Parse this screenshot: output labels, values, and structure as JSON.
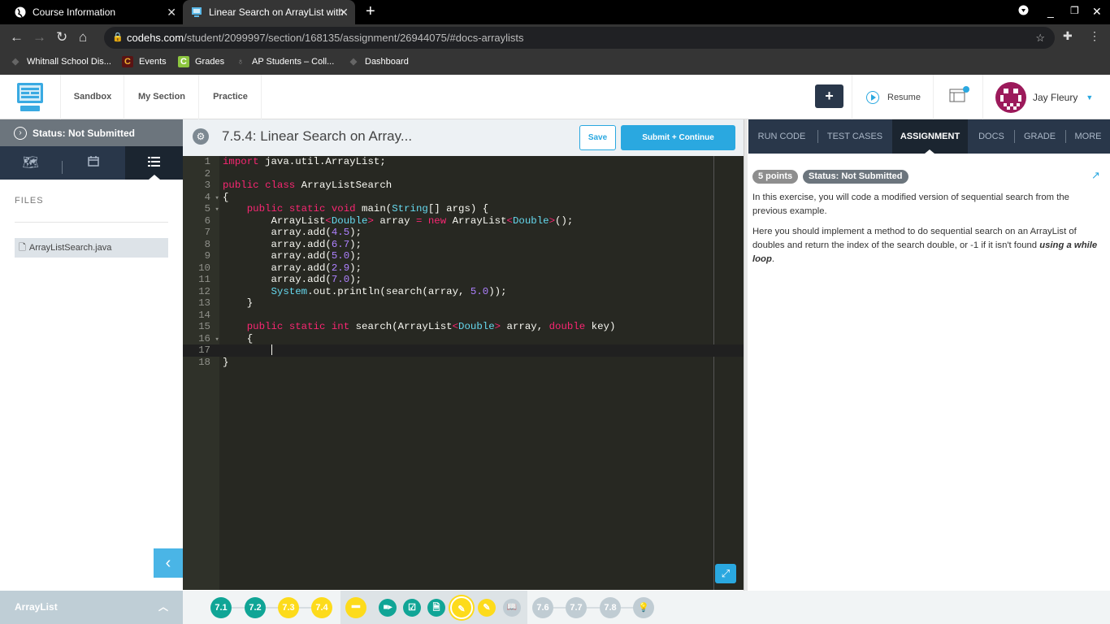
{
  "browser": {
    "tabs": [
      {
        "title": "Course Information",
        "icon": "globe-icon"
      },
      {
        "title": "Linear Search on ArrayList with W",
        "icon": "codehs-icon",
        "active": true
      }
    ],
    "url_host": "codehs.com",
    "url_path": "/student/2099997/section/168135/assignment/26944075/#docs-arraylists",
    "bookmarks": [
      {
        "label": "Whitnall School Dis...",
        "icon": "falcon-icon"
      },
      {
        "label": "Events",
        "icon": "C"
      },
      {
        "label": "Grades",
        "icon": "C"
      },
      {
        "label": "AP Students – Coll...",
        "icon": "acorn-icon"
      },
      {
        "label": "Dashboard",
        "icon": "falcon-icon"
      }
    ]
  },
  "header": {
    "nav": [
      "Sandbox",
      "My Section",
      "Practice"
    ],
    "plus_label": "+",
    "resume_label": "Resume",
    "user_name": "Jay Fleury"
  },
  "left_panel": {
    "status": "Status: Not Submitted",
    "files_label": "FILES",
    "files": [
      "ArrayListSearch.java"
    ],
    "module_label": "ArrayList"
  },
  "editor": {
    "title": "7.5.4: Linear Search on Array...",
    "save_label": "Save",
    "submit_label": "Submit + Continue",
    "lines": [
      {
        "n": "1",
        "fold": false
      },
      {
        "n": "2",
        "fold": false
      },
      {
        "n": "3",
        "fold": false
      },
      {
        "n": "4",
        "fold": true
      },
      {
        "n": "5",
        "fold": true
      },
      {
        "n": "6",
        "fold": false
      },
      {
        "n": "7",
        "fold": false
      },
      {
        "n": "8",
        "fold": false
      },
      {
        "n": "9",
        "fold": false
      },
      {
        "n": "10",
        "fold": false
      },
      {
        "n": "11",
        "fold": false
      },
      {
        "n": "12",
        "fold": false
      },
      {
        "n": "13",
        "fold": false
      },
      {
        "n": "14",
        "fold": false
      },
      {
        "n": "15",
        "fold": false
      },
      {
        "n": "16",
        "fold": true
      },
      {
        "n": "17",
        "fold": false
      },
      {
        "n": "18",
        "fold": false
      }
    ],
    "code": [
      [
        [
          "kw",
          "import"
        ],
        [
          "",
          " java.util.ArrayList;"
        ]
      ],
      [],
      [
        [
          "kw",
          "public"
        ],
        [
          "",
          " "
        ],
        [
          "kw",
          "class"
        ],
        [
          "",
          " ArrayListSearch"
        ]
      ],
      [
        [
          "",
          "{"
        ]
      ],
      [
        [
          "",
          "    "
        ],
        [
          "kw",
          "public"
        ],
        [
          "",
          " "
        ],
        [
          "kw",
          "static"
        ],
        [
          "",
          " "
        ],
        [
          "kw",
          "void"
        ],
        [
          "",
          " main("
        ],
        [
          "ty",
          "String"
        ],
        [
          "",
          "[] args) {"
        ]
      ],
      [
        [
          "",
          "        ArrayList"
        ],
        [
          "kw",
          "<"
        ],
        [
          "ty",
          "Double"
        ],
        [
          "kw",
          ">"
        ],
        [
          "",
          " array "
        ],
        [
          "kw",
          "="
        ],
        [
          "",
          " "
        ],
        [
          "kw",
          "new"
        ],
        [
          "",
          " ArrayList"
        ],
        [
          "kw",
          "<"
        ],
        [
          "ty",
          "Double"
        ],
        [
          "kw",
          ">"
        ],
        [
          "",
          "();"
        ]
      ],
      [
        [
          "",
          "        array.add("
        ],
        [
          "nm",
          "4.5"
        ],
        [
          "",
          ");"
        ]
      ],
      [
        [
          "",
          "        array.add("
        ],
        [
          "nm",
          "6.7"
        ],
        [
          "",
          ");"
        ]
      ],
      [
        [
          "",
          "        array.add("
        ],
        [
          "nm",
          "5.0"
        ],
        [
          "",
          ");"
        ]
      ],
      [
        [
          "",
          "        array.add("
        ],
        [
          "nm",
          "2.9"
        ],
        [
          "",
          ");"
        ]
      ],
      [
        [
          "",
          "        array.add("
        ],
        [
          "nm",
          "7.0"
        ],
        [
          "",
          ");"
        ]
      ],
      [
        [
          "",
          "        "
        ],
        [
          "ty",
          "System"
        ],
        [
          "",
          ".out.println(search(array, "
        ],
        [
          "nm",
          "5.0"
        ],
        [
          "",
          "));"
        ]
      ],
      [
        [
          "",
          "    }"
        ]
      ],
      [],
      [
        [
          "",
          "    "
        ],
        [
          "kw",
          "public"
        ],
        [
          "",
          " "
        ],
        [
          "kw",
          "static"
        ],
        [
          "",
          " "
        ],
        [
          "kw",
          "int"
        ],
        [
          "",
          " search(ArrayList"
        ],
        [
          "kw",
          "<"
        ],
        [
          "ty",
          "Double"
        ],
        [
          "kw",
          ">"
        ],
        [
          "",
          " array, "
        ],
        [
          "kw",
          "double"
        ],
        [
          "",
          " key)"
        ]
      ],
      [
        [
          "",
          "    {"
        ]
      ],
      [
        [
          "",
          "        "
        ],
        [
          "caret",
          ""
        ]
      ],
      [
        [
          "",
          "}"
        ]
      ]
    ]
  },
  "right_panel": {
    "tabs": [
      "RUN CODE",
      "TEST CASES",
      "ASSIGNMENT",
      "DOCS",
      "GRADE",
      "MORE"
    ],
    "active_tab": "ASSIGNMENT",
    "points_badge": "5 points",
    "status_badge": "Status: Not Submitted",
    "paragraph1": "In this exercise, you will code a modified version of sequential search from the previous example.",
    "paragraph2": "Here you should implement a method to do sequential search on an ArrayList of doubles and return the index of the search double, or -1 if it isn't found ",
    "paragraph2_emphasis": "using a while loop",
    "paragraph2_end": "."
  },
  "progress": {
    "items": [
      {
        "label": "7.1",
        "state": "complete"
      },
      {
        "label": "7.2",
        "state": "complete"
      },
      {
        "label": "7.3",
        "state": "in-progress"
      },
      {
        "label": "7.4",
        "state": "in-progress"
      },
      {
        "label": "—",
        "state": "current-lesson"
      },
      {
        "label": "video-icon",
        "state": "complete"
      },
      {
        "label": "check-icon",
        "state": "complete"
      },
      {
        "label": "document-icon",
        "state": "complete"
      },
      {
        "label": "pencil-icon",
        "state": "current"
      },
      {
        "label": "pencil-icon",
        "state": "in-progress"
      },
      {
        "label": "book-icon",
        "state": "locked"
      },
      {
        "label": "7.6",
        "state": "locked"
      },
      {
        "label": "7.7",
        "state": "locked"
      },
      {
        "label": "7.8",
        "state": "locked"
      },
      {
        "label": "lightbulb-icon",
        "state": "locked"
      }
    ]
  }
}
